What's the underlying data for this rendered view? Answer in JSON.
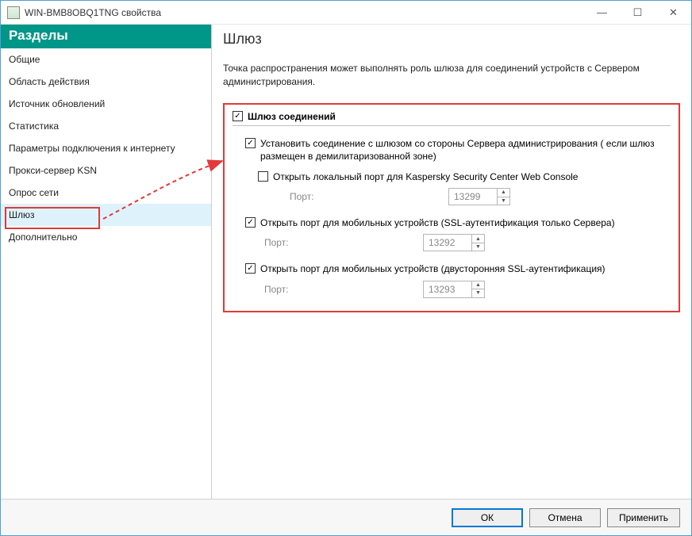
{
  "window": {
    "title": "WIN-BMB8OBQ1TNG свойства"
  },
  "sidebar": {
    "header": "Разделы",
    "items": [
      {
        "label": "Общие"
      },
      {
        "label": "Область действия"
      },
      {
        "label": "Источник обновлений"
      },
      {
        "label": "Статистика"
      },
      {
        "label": "Параметры подключения к интернету"
      },
      {
        "label": "Прокси-сервер KSN"
      },
      {
        "label": "Опрос сети"
      },
      {
        "label": "Шлюз"
      },
      {
        "label": "Дополнительно"
      }
    ]
  },
  "main": {
    "title": "Шлюз",
    "description": "Точка распространения может выполнять роль шлюза для соединений устройств с Сервером администрирования."
  },
  "gateway": {
    "master_label": "Шлюз соединений",
    "opt_admin": "Установить соединение с шлюзом со стороны Сервера администрирования ( если шлюз размещен в демилитаризованной зоне)",
    "opt_webconsole": "Открыть локальный порт для Kaspersky Security Center Web Console",
    "port_label": "Порт:",
    "port_webconsole": "13299",
    "opt_mobile_server_ssl": "Открыть порт для мобильных устройств (SSL-аутентификация только Сервера)",
    "port_mobile_server": "13292",
    "opt_mobile_twoway_ssl": "Открыть порт для мобильных устройств (двусторонняя SSL-аутентификация)",
    "port_mobile_twoway": "13293"
  },
  "footer": {
    "ok": "ОК",
    "cancel": "Отмена",
    "apply": "Применить"
  }
}
